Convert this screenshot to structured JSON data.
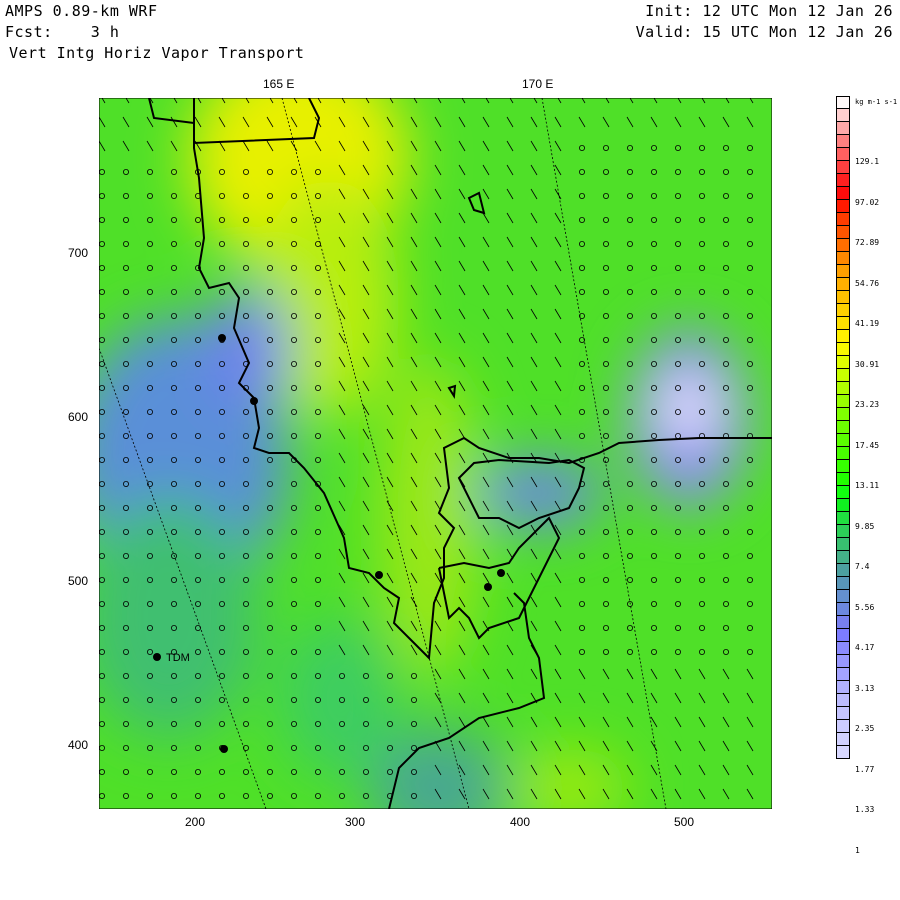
{
  "header": {
    "model": "AMPS 0.89-km WRF",
    "fcst": "Fcst:    3 h",
    "field": "Vert Intg Horiz Vapor Transport",
    "init": "Init: 12 UTC Mon 12 Jan 26",
    "valid": "Valid: 15 UTC Mon 12 Jan 26"
  },
  "lon_labels": [
    "165 E",
    "170 E"
  ],
  "x_ticks": [
    "200",
    "300",
    "400",
    "500"
  ],
  "y_ticks": [
    "700",
    "600",
    "500",
    "400"
  ],
  "station": "TDM",
  "colorbar": {
    "units": "kg m-1 s-1",
    "labels": [
      "129.1",
      "97.02",
      "72.89",
      "54.76",
      "41.19",
      "30.91",
      "23.23",
      "17.45",
      "13.11",
      "9.85",
      "7.4",
      "5.56",
      "4.17",
      "3.13",
      "2.35",
      "1.77",
      "1.33",
      "1"
    ]
  }
}
